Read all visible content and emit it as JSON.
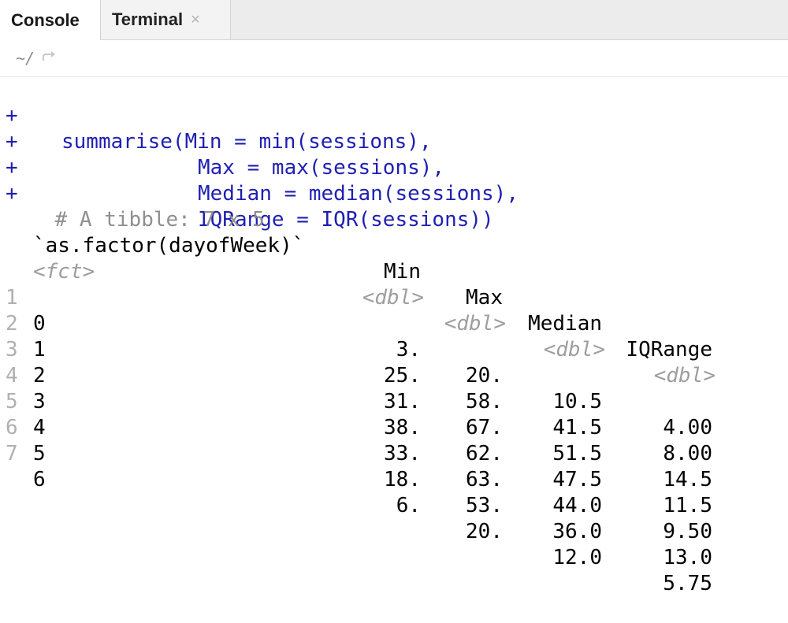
{
  "tabs": {
    "console": "Console",
    "terminal": "Terminal",
    "close_glyph": "×"
  },
  "path": {
    "dir": "~/",
    "icon": "goto-directory-icon"
  },
  "console": {
    "prompt_char": "+",
    "code_lines": [
      "summarise(Min = min(sessions),",
      "Max = max(sessions),",
      "Median = median(sessions),",
      "IQRange = IQR(sessions))"
    ],
    "tibble_comment": "# A tibble: 7 x 5",
    "headers": [
      "`as.factor(dayofWeek)`",
      "Min",
      "Max",
      "Median",
      "IQRange"
    ],
    "types": [
      "<fct>",
      "<dbl>",
      "<dbl>",
      "<dbl>",
      "<dbl>"
    ],
    "rows": [
      {
        "idx": "1",
        "day": "0",
        "min": "3.",
        "max": "20.",
        "median": "10.5",
        "iqr": "4.00"
      },
      {
        "idx": "2",
        "day": "1",
        "min": "25.",
        "max": "58.",
        "median": "41.5",
        "iqr": "8.00"
      },
      {
        "idx": "3",
        "day": "2",
        "min": "31.",
        "max": "67.",
        "median": "51.5",
        "iqr": "14.5"
      },
      {
        "idx": "4",
        "day": "3",
        "min": "38.",
        "max": "62.",
        "median": "47.5",
        "iqr": "11.5"
      },
      {
        "idx": "5",
        "day": "4",
        "min": "33.",
        "max": "63.",
        "median": "44.0",
        "iqr": "9.50"
      },
      {
        "idx": "6",
        "day": "5",
        "min": "18.",
        "max": "53.",
        "median": "36.0",
        "iqr": "13.0"
      },
      {
        "idx": "7",
        "day": "6",
        "min": "6.",
        "max": "20.",
        "median": "12.0",
        "iqr": "5.75"
      }
    ]
  }
}
